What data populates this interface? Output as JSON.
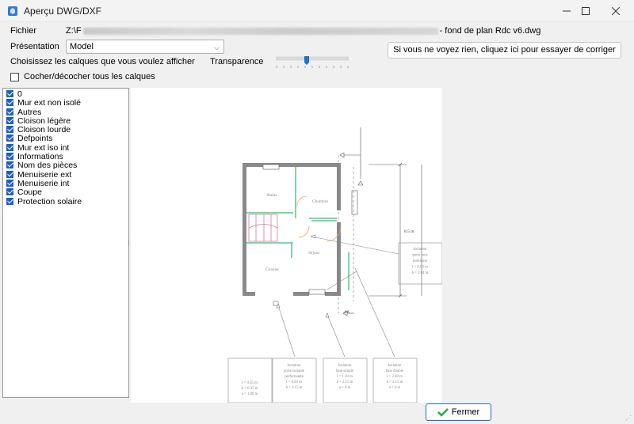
{
  "window": {
    "title": "Aperçu DWG/DXF",
    "minimize_icon": "minimize-icon",
    "maximize_icon": "maximize-icon",
    "close_icon": "close-icon"
  },
  "file": {
    "label": "Fichier",
    "path_prefix": "Z:\\F",
    "path_suffix": "- fond de plan Rdc v6.dwg"
  },
  "presentation": {
    "label": "Présentation",
    "value": "Model"
  },
  "fix_button": {
    "label": "Si vous ne voyez rien, cliquez ici pour essayer de corriger"
  },
  "layers_prompt": "Choisissez les calques que vous voulez afficher",
  "transparency": {
    "label": "Transparence",
    "value_fraction": 0.42
  },
  "toggle_all": {
    "label": "Cocher/décocher tous les calques",
    "checked": false
  },
  "layers": [
    {
      "name": "0",
      "checked": true
    },
    {
      "name": "Mur ext non isolé",
      "checked": true
    },
    {
      "name": "Autres",
      "checked": true
    },
    {
      "name": "Cloison légère",
      "checked": true
    },
    {
      "name": "Cloison lourde",
      "checked": true
    },
    {
      "name": "Defpoints",
      "checked": true
    },
    {
      "name": "Mur ext iso int",
      "checked": true
    },
    {
      "name": "Informations",
      "checked": true
    },
    {
      "name": "Nom des pièces",
      "checked": true
    },
    {
      "name": "Menuiserie ext",
      "checked": true
    },
    {
      "name": "Menuiserie int",
      "checked": true
    },
    {
      "name": "Coupe",
      "checked": true
    },
    {
      "name": "Protection solaire",
      "checked": true
    }
  ],
  "drawing": {
    "rooms": {
      "bain": "Bains",
      "chambre": "Chambre",
      "sejour": "Séjour",
      "cuisine": "Cuisine"
    },
    "dimension": "8.5 m",
    "section_mark": "AA",
    "callout_right": [
      "Isolation",
      "porte bois",
      "intérieure",
      "l = 0.83 m",
      "h = 2.04 m"
    ],
    "callout_bottom_1": [
      "l = 0.35 m",
      "h = 0.35 m",
      "a = 1.80 m"
    ],
    "callout_bottom_2": [
      "Isolation",
      "porte isolante",
      "performante",
      "l = 0.83 m",
      "h = 2.15 m"
    ],
    "callout_bottom_3": [
      "Isolation",
      "baie simple",
      "l = 1.20 m",
      "h = 2.15 m",
      "a = 0 m"
    ],
    "callout_bottom_4": [
      "Isolation",
      "baie double",
      "l = 2.40 m",
      "h = 2.15 m",
      "a = 0 m"
    ]
  },
  "footer": {
    "close_label": "Fermer",
    "check_icon": "checkmark-icon"
  }
}
